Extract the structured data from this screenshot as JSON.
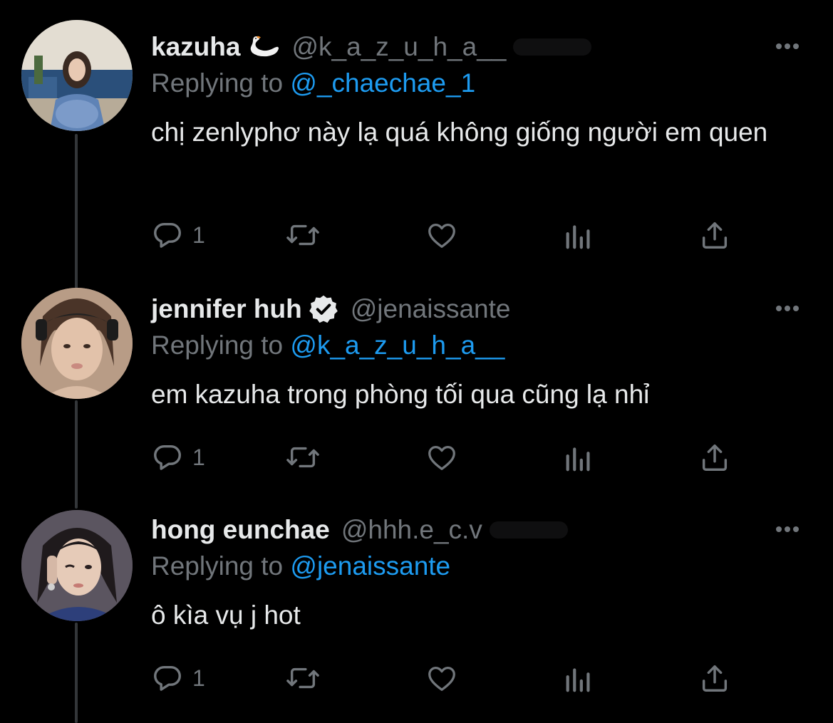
{
  "theme": {
    "background": "#000000",
    "text": "#e7e9ea",
    "muted": "#71767b",
    "link": "#1d9bf0",
    "thread_line": "#333639"
  },
  "replying_prefix": "Replying to ",
  "tweets": [
    {
      "display_name": "kazuha",
      "name_emoji": "swan-emoji",
      "handle": "@k_a_z_u_h_a__",
      "verified": false,
      "reply_to": "@_chaechae_1",
      "text": "chị zenlyphơ này lạ quá không giống người em quen",
      "actions": {
        "reply_count": "1",
        "retweet_count": "",
        "like_count": ""
      }
    },
    {
      "display_name": "jennifer huh",
      "handle": "@jenaissante",
      "verified": true,
      "reply_to": "@k_a_z_u_h_a__",
      "text": "em kazuha trong phòng tối qua cũng lạ nhỉ",
      "actions": {
        "reply_count": "1",
        "retweet_count": "",
        "like_count": ""
      }
    },
    {
      "display_name": "hong eunchae",
      "handle": "@hhh.e_c.v",
      "verified": false,
      "reply_to": "@jenaissante",
      "text": "ô kìa vụ j hot",
      "actions": {
        "reply_count": "1",
        "retweet_count": "",
        "like_count": ""
      }
    }
  ],
  "icons": {
    "reply": "reply-icon",
    "retweet": "retweet-icon",
    "like": "heart-icon",
    "views": "analytics-icon",
    "share": "share-icon",
    "more": "more-icon",
    "verified": "verified-badge-icon"
  }
}
